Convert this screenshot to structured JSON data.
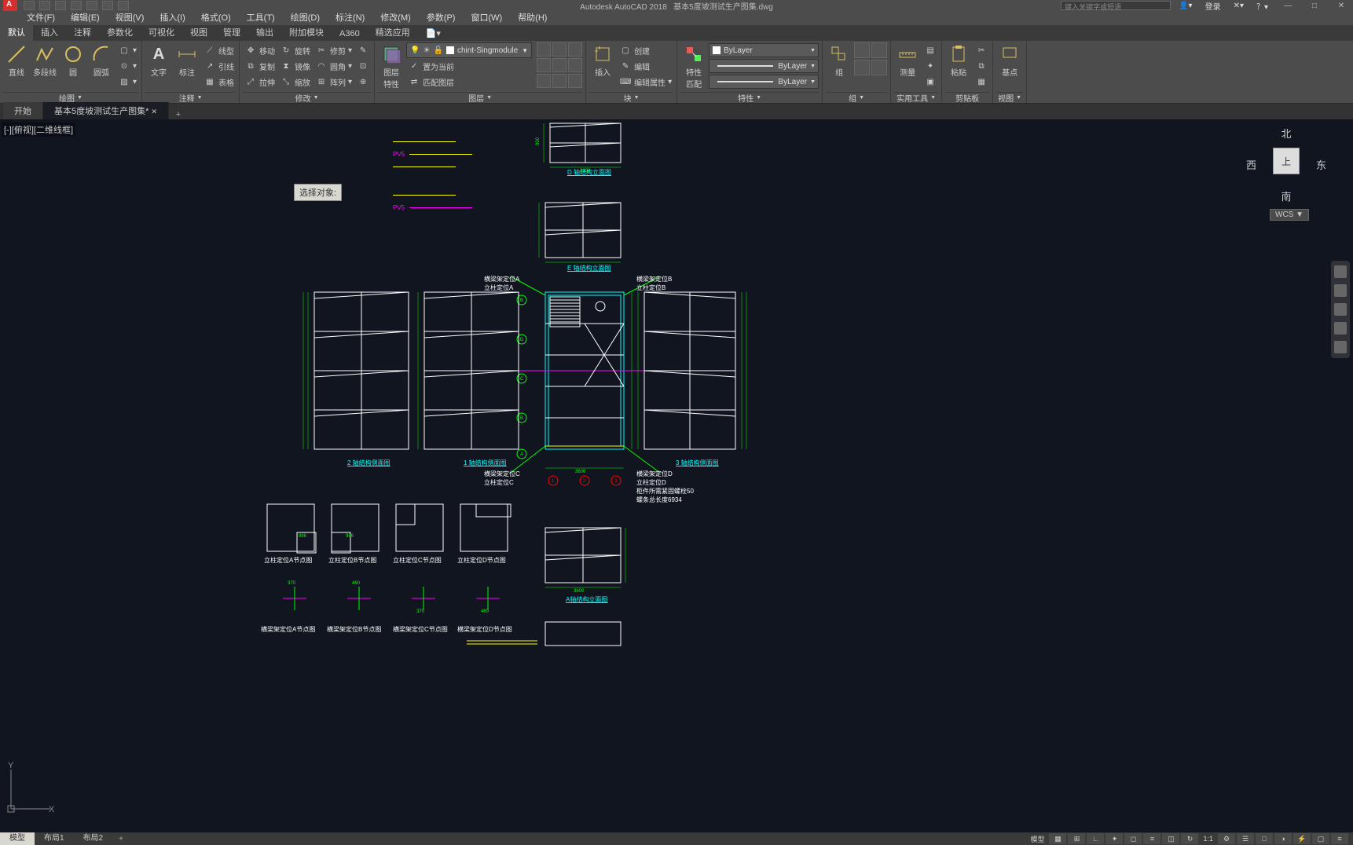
{
  "app": {
    "name": "Autodesk AutoCAD 2018",
    "file": "基本5度坡测试生产图集.dwg"
  },
  "title_right": {
    "search_ph": "键入关键字或短语",
    "login": "登录"
  },
  "win_buttons": {
    "min": "—",
    "max": "□",
    "close": "✕"
  },
  "menu": [
    "文件(F)",
    "编辑(E)",
    "视图(V)",
    "插入(I)",
    "格式(O)",
    "工具(T)",
    "绘图(D)",
    "标注(N)",
    "修改(M)",
    "参数(P)",
    "窗口(W)",
    "帮助(H)"
  ],
  "ribbon_tabs": [
    "默认",
    "插入",
    "注释",
    "参数化",
    "可视化",
    "视图",
    "管理",
    "输出",
    "附加模块",
    "A360",
    "精选应用"
  ],
  "ribbon": {
    "draw": {
      "title": "绘图",
      "line": "直线",
      "pline": "多段线",
      "circle": "圆",
      "arc": "圆弧"
    },
    "annot": {
      "title": "注释",
      "text": "文字",
      "dim": "标注"
    },
    "modify": {
      "title": "修改",
      "move": "移动",
      "rotate": "旋转",
      "trim": "修剪",
      "copy": "复制",
      "mirror": "镜像",
      "fillet": "圆角",
      "stretch": "拉伸",
      "scale": "缩放",
      "array": "阵列"
    },
    "layer": {
      "title": "图层",
      "props": "图层\n特性",
      "set_current": "置为当前",
      "match": "匹配图层",
      "current_layer": "chint-Singmodule",
      "extras": [
        "线型",
        "引线",
        "表格"
      ]
    },
    "block": {
      "title": "块",
      "insert": "插入",
      "create": "创建",
      "edit": "编辑",
      "editattr": "编辑属性"
    },
    "props": {
      "title": "特性",
      "btn": "特性\n匹配",
      "color": "ByLayer",
      "lweight": "ByLayer",
      "ltype": "ByLayer"
    },
    "group": {
      "title": "组",
      "btn": "组"
    },
    "util": {
      "title": "实用工具",
      "measure": "测量"
    },
    "clip": {
      "title": "剪贴板",
      "paste": "粘贴"
    },
    "view": {
      "title": "视图",
      "base": "基点"
    }
  },
  "doc_tabs": {
    "start": "开始",
    "current": "基本5度坡测试生产图集*"
  },
  "view_controls": "[-][俯视][二维线框]",
  "tooltip": "选择对象:",
  "viewcube": {
    "n": "北",
    "s": "南",
    "e": "东",
    "w": "西",
    "top": "上",
    "wcs": "WCS"
  },
  "model_tabs": {
    "model": "模型",
    "layout1": "布局1",
    "layout2": "布局2"
  },
  "status": {
    "model": "模型",
    "scale": "1:1"
  },
  "drawing_labels": {
    "t1": "D 轴结构立面图",
    "t2": "E 轴结构立面图",
    "l1": "2 轴结构侧面图",
    "l2": "1 轴结构侧面图",
    "l3": "3 轴结构侧面图",
    "a1": "横梁架定位A\n立柱定位A",
    "a2": "横梁架定位B\n立柱定位B",
    "a3": "横梁架定位C\n立柱定位C",
    "a4": "横梁架定位D\n立柱定位D",
    "a5": "柜件所需紧固螺栓50\n螺条总长度6934",
    "d1": "立柱定位A节点图",
    "d2": "立柱定位B节点图",
    "d3": "立柱定位C节点图",
    "d4": "立柱定位D节点图",
    "e1": "横梁架定位A节点图",
    "e2": "横梁架定位B节点图",
    "e3": "横梁架定位C节点图",
    "e4": "横梁架定位D节点图",
    "b1": "A轴结构立面图"
  },
  "ucs": {
    "x": "X",
    "y": "Y"
  }
}
